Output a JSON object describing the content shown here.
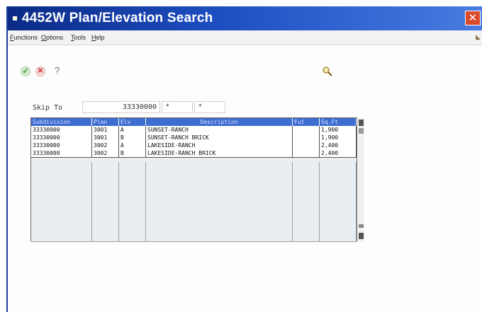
{
  "window": {
    "title": "4452W   Plan/Elevation Search",
    "close_glyph": "✕"
  },
  "menu": {
    "items": [
      {
        "first": "F",
        "rest": "unctions"
      },
      {
        "first": "O",
        "rest": "ptions"
      },
      {
        "first": "T",
        "rest": "ools"
      },
      {
        "first": "H",
        "rest": "elp"
      }
    ]
  },
  "toolbar": {
    "ok_glyph": "✓",
    "cancel_glyph": "✕",
    "help_glyph": "?"
  },
  "skip_to": {
    "label": "Skip To",
    "value": "33330000",
    "plan_value": "*",
    "elev_value": "*"
  },
  "grid": {
    "columns": [
      "Subdivision",
      "Plan",
      "Elv",
      "Description",
      "Fut",
      "Sq.Ft"
    ],
    "rows": [
      [
        "33330000",
        "3001",
        "A",
        "SUNSET-RANCH",
        "",
        "1,900"
      ],
      [
        "33330000",
        "3001",
        "B",
        "SUNSET-RANCH BRICK",
        "",
        "1,900"
      ],
      [
        "33330000",
        "3002",
        "A",
        "LAKESIDE-RANCH",
        "",
        "2,400"
      ],
      [
        "33330000",
        "3002",
        "B",
        "LAKESIDE-RANCH BRICK",
        "",
        "2,400"
      ]
    ]
  },
  "icons": {
    "title": "app-icon",
    "ok": "checkmark-icon",
    "cancel": "cancel-x-icon",
    "help": "question-mark-icon",
    "find": "magnifier-icon"
  },
  "colors": {
    "title_bar": "#1e4fc2",
    "grid_header": "#3d6dd0",
    "close_button": "#d9492a"
  }
}
